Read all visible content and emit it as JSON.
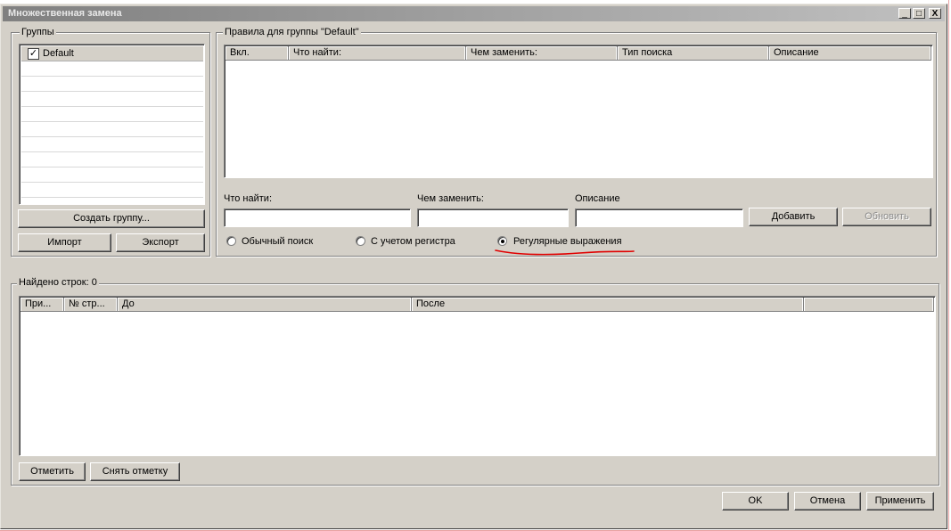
{
  "window": {
    "title": "Множественная замена",
    "controls": [
      "_",
      "□",
      "X"
    ]
  },
  "groups": {
    "label": "Группы",
    "items": [
      {
        "name": "Default",
        "checked": true
      }
    ],
    "create_button": "Создать группу...",
    "import_button": "Импорт",
    "export_button": "Экспорт"
  },
  "rules": {
    "label": "Правила для группы \"Default\"",
    "columns": [
      "Вкл.",
      "Что найти:",
      "Чем заменить:",
      "Тип поиска",
      "Описание"
    ],
    "find_label": "Что найти:",
    "replace_label": "Чем заменить:",
    "description_label": "Описание",
    "find_value": "",
    "replace_value": "",
    "description_value": "",
    "add_button": "Добавить",
    "update_button": "Обновить",
    "search_modes": [
      {
        "label": "Обычный поиск",
        "selected": false
      },
      {
        "label": "С учетом регистра",
        "selected": false
      },
      {
        "label": "Регулярные выражения",
        "selected": true
      }
    ],
    "annotation_color": "#e00000"
  },
  "results": {
    "label": "Найдено строк: 0",
    "columns": [
      "При...",
      "№ стр...",
      "До",
      "После",
      ""
    ],
    "mark_button": "Отметить",
    "unmark_button": "Снять отметку"
  },
  "footer": {
    "ok": "OK",
    "cancel": "Отмена",
    "apply": "Применить"
  }
}
